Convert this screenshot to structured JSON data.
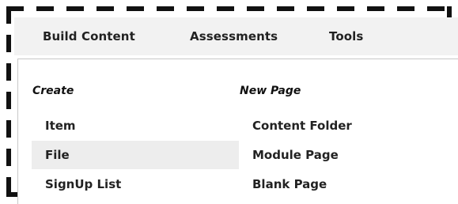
{
  "tabs": {
    "build_content": "Build Content",
    "assessments": "Assessments",
    "tools": "Tools"
  },
  "menu": {
    "create": {
      "heading": "Create",
      "items": [
        "Item",
        "File",
        "SignUp List"
      ],
      "highlighted": "File"
    },
    "new_page": {
      "heading": "New Page",
      "items": [
        "Content Folder",
        "Module Page",
        "Blank Page"
      ]
    }
  }
}
